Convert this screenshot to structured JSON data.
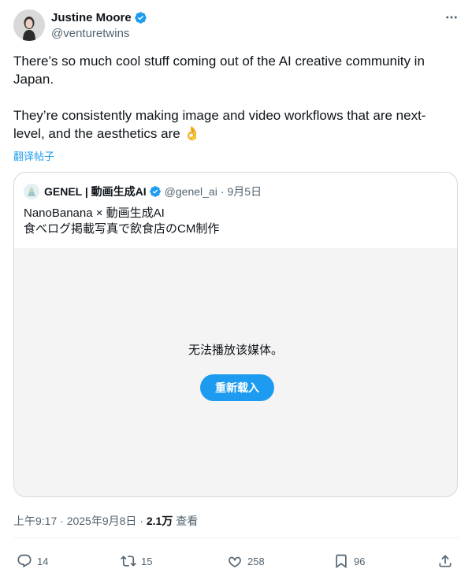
{
  "author": {
    "name": "Justine Moore",
    "handle": "@venturetwins"
  },
  "tweet": {
    "text": "There’s so much cool stuff coming out of the AI creative community in\nJapan.\n\nThey’re consistently making image and video workflows that are next-\nlevel, and the aesthetics are ",
    "emoji": "👌",
    "translate_label": "翻译帖子"
  },
  "quoted": {
    "name": "GENEL | 動画生成AI",
    "handle": "@genel_ai",
    "separator": "·",
    "date": "9月5日",
    "text": "NanoBanana × 動画生成AI\n食べログ掲載写真で飲食店のCM制作",
    "media_message": "无法播放该媒体。",
    "reload_label": "重新载入"
  },
  "meta": {
    "time": "上午9:17 · 2025年9月8日 · ",
    "views": "2.1万",
    "views_label": " 查看"
  },
  "actions": {
    "replies": "14",
    "retweets": "15",
    "likes": "258",
    "bookmarks": "96"
  },
  "colors": {
    "accent": "#1d9bf0",
    "secondary_text": "#536471",
    "border": "#cfd9de"
  }
}
